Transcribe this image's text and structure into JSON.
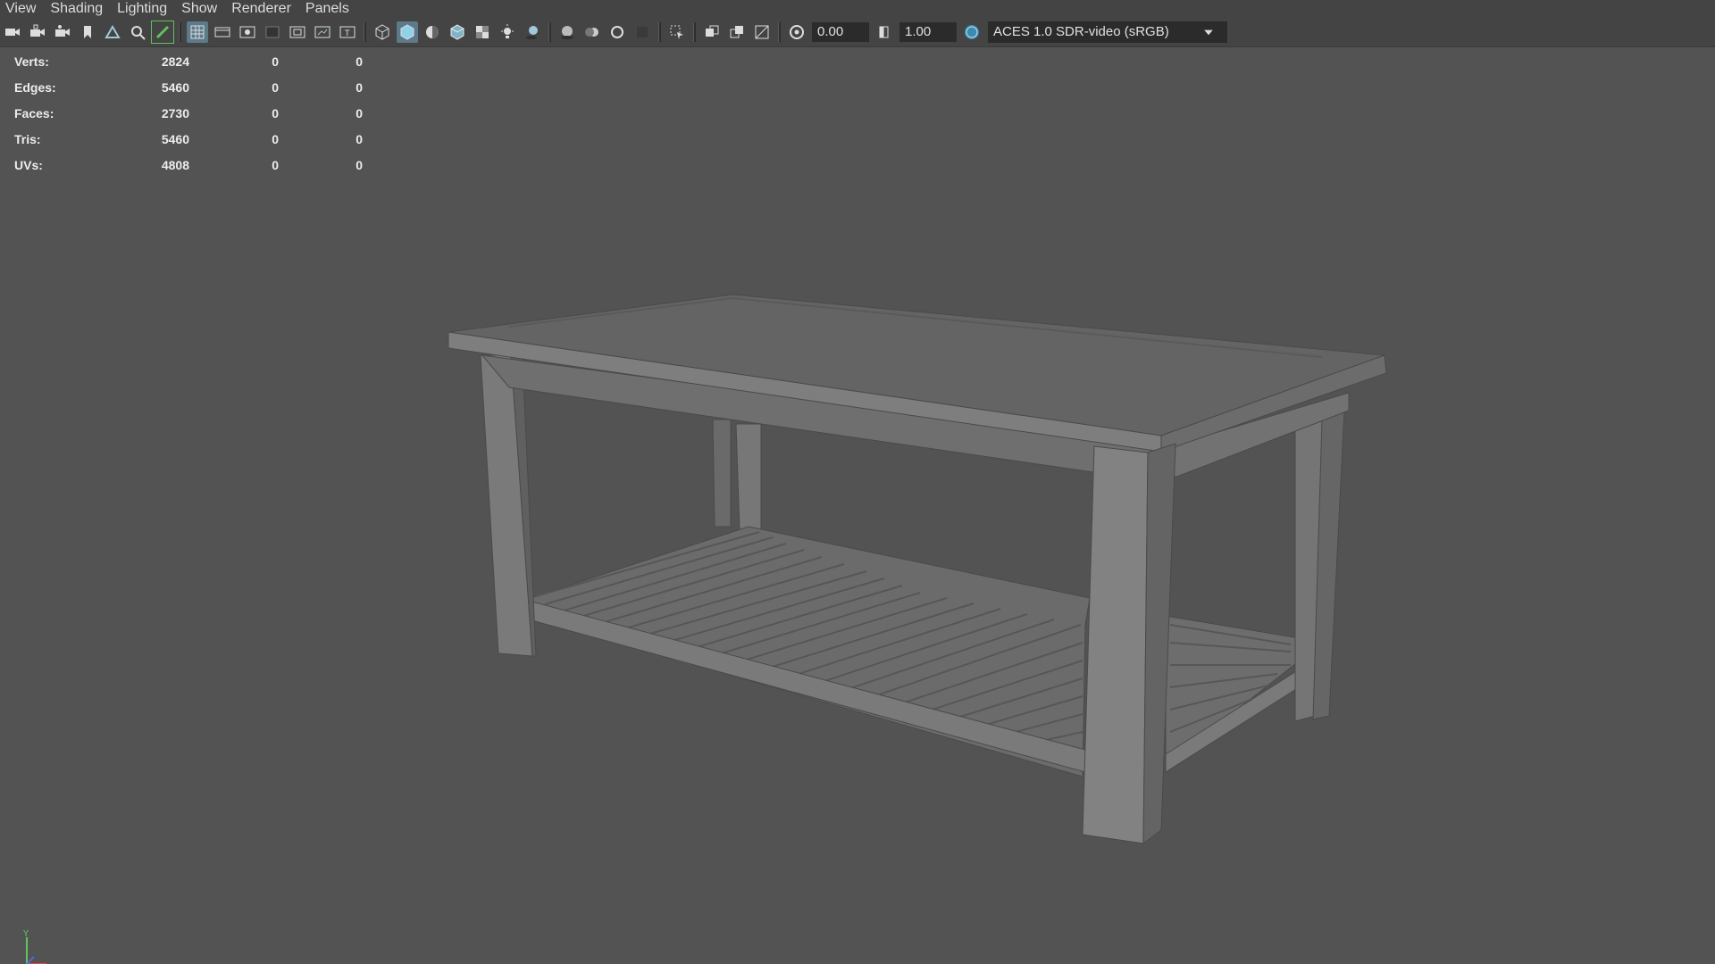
{
  "menu": [
    "View",
    "Shading",
    "Lighting",
    "Show",
    "Renderer",
    "Panels"
  ],
  "toolbar": {
    "exposure": "0.00",
    "gamma": "1.00",
    "color_space": "ACES 1.0 SDR-video (sRGB)",
    "color_mgmt_badge": "ON"
  },
  "stats": [
    {
      "label": "Verts:",
      "v1": "2824",
      "v2": "0",
      "v3": "0"
    },
    {
      "label": "Edges:",
      "v1": "5460",
      "v2": "0",
      "v3": "0"
    },
    {
      "label": "Faces:",
      "v1": "2730",
      "v2": "0",
      "v3": "0"
    },
    {
      "label": "Tris:",
      "v1": "5460",
      "v2": "0",
      "v3": "0"
    },
    {
      "label": "UVs:",
      "v1": "4808",
      "v2": "0",
      "v3": "0"
    }
  ],
  "axis": {
    "y_label": "Y"
  },
  "colors": {
    "viewport_bg": "#535353",
    "ui_bg": "#444444",
    "field_bg": "#2b2b2b",
    "accent": "#5c7a8a",
    "highlight_green": "#61c25a"
  }
}
